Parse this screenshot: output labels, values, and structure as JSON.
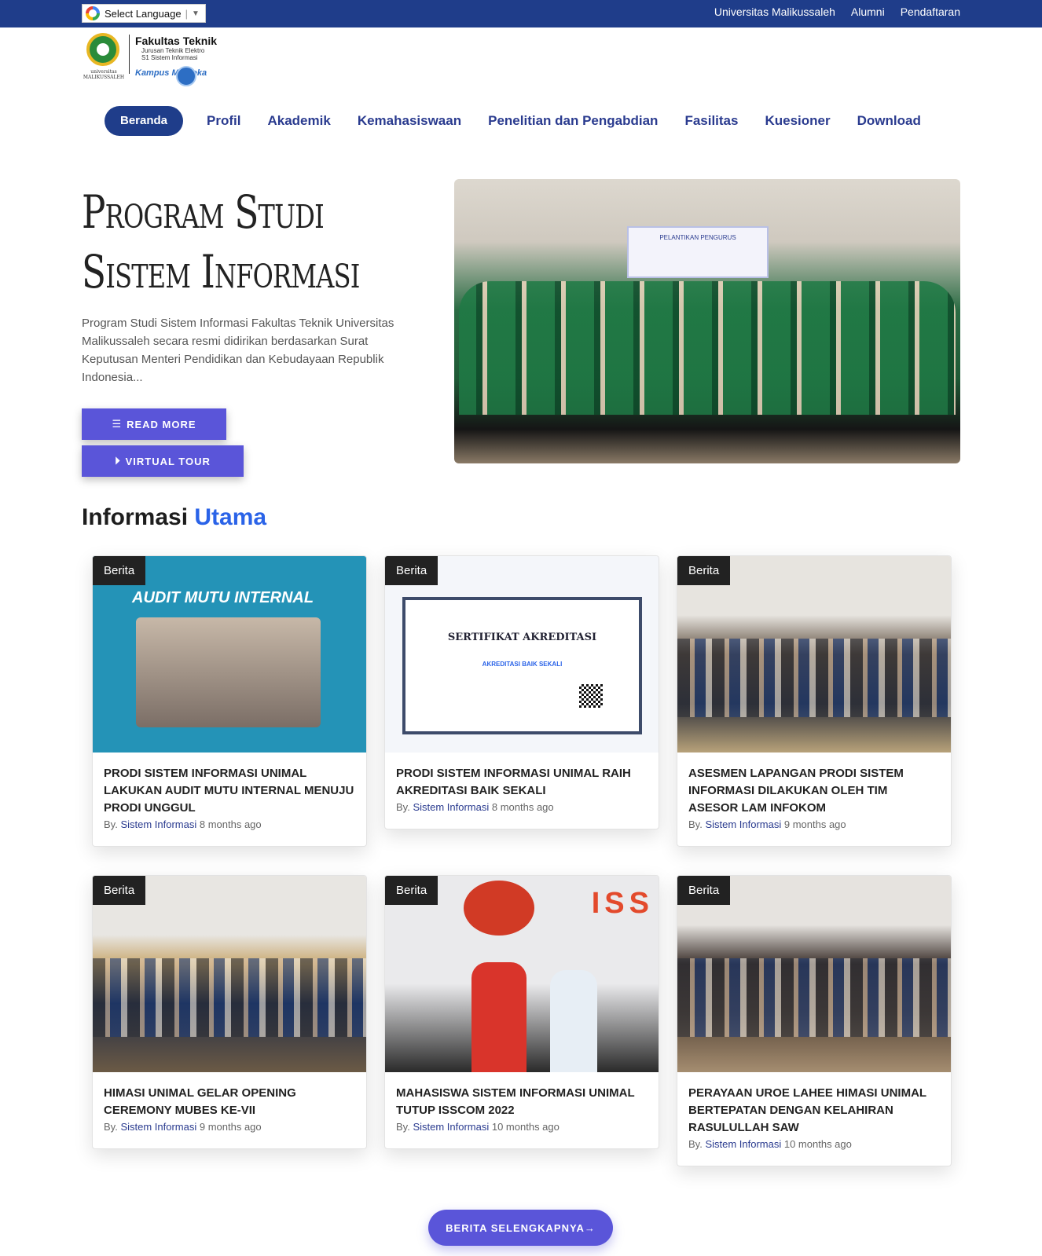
{
  "topbar": {
    "language": "Select Language",
    "links": [
      "Universitas Malikussaleh",
      "Alumni",
      "Pendaftaran"
    ]
  },
  "logo": {
    "university": "universitas MALIKUSSALEH",
    "faculty": "Fakultas Teknik",
    "dept": "Jurusan Teknik Elektro",
    "program": "S1 Sistem Informasi",
    "kampus": "Kampus Merdeka"
  },
  "nav": {
    "items": [
      "Beranda",
      "Profil",
      "Akademik",
      "Kemahasiswaan",
      "Penelitian dan Pengabdian",
      "Fasilitas",
      "Kuesioner",
      "Download"
    ]
  },
  "hero": {
    "title_line1": "Program Studi",
    "title_line2": "Sistem Informasi",
    "description": "Program Studi Sistem Informasi Fakultas Teknik Universitas Malikussaleh secara resmi didirikan berdasarkan Surat Keputusan Menteri Pendidikan dan Kebudayaan Republik Indonesia...",
    "read_more": "READ MORE",
    "virtual_tour": "VIRTUAL TOUR",
    "photo_caption": "PELANTIKAN PENGURUS"
  },
  "section": {
    "title_main": "Informasi ",
    "title_accent": "Utama"
  },
  "cards": [
    {
      "tag": "Berita",
      "title": "PRODI SISTEM INFORMASI UNIMAL LAKUKAN AUDIT MUTU INTERNAL MENUJU PRODI UNGGUL",
      "by": "By. ",
      "author": "Sistem Informasi",
      "time": " 8 months ago",
      "image_text": "AUDIT MUTU INTERNAL"
    },
    {
      "tag": "Berita",
      "title": "PRODI SISTEM INFORMASI UNIMAL RAIH AKREDITASI BAIK SEKALI",
      "by": "By. ",
      "author": "Sistem Informasi",
      "time": " 8 months ago",
      "image_text": "SERTIFIKAT AKREDITASI",
      "image_sub": "AKREDITASI BAIK SEKALI"
    },
    {
      "tag": "Berita",
      "title": "ASESMEN LAPANGAN PRODI SISTEM INFORMASI DILAKUKAN OLEH TIM ASESOR LAM INFOKOM",
      "by": "By. ",
      "author": "Sistem Informasi",
      "time": " 9 months ago"
    },
    {
      "tag": "Berita",
      "title": "HIMASI UNIMAL GELAR OPENING CEREMONY MUBES KE-VII",
      "by": "By. ",
      "author": "Sistem Informasi",
      "time": " 9 months ago"
    },
    {
      "tag": "Berita",
      "title": "MAHASISWA SISTEM INFORMASI UNIMAL TUTUP ISSCOM 2022",
      "by": "By. ",
      "author": "Sistem Informasi",
      "time": " 10 months ago",
      "image_text": "ISS"
    },
    {
      "tag": "Berita",
      "title": "PERAYAAN UROE LAHEE HIMASI UNIMAL BERTEPATAN DENGAN KELAHIRAN RASULULLAH SAW",
      "by": "By. ",
      "author": "Sistem Informasi",
      "time": " 10 months ago"
    }
  ],
  "more_button": "BERITA SELENGKAPNYA→",
  "colors": {
    "primary": "#1f3d8a",
    "button": "#5a55d9",
    "accent": "#2a63e8"
  }
}
